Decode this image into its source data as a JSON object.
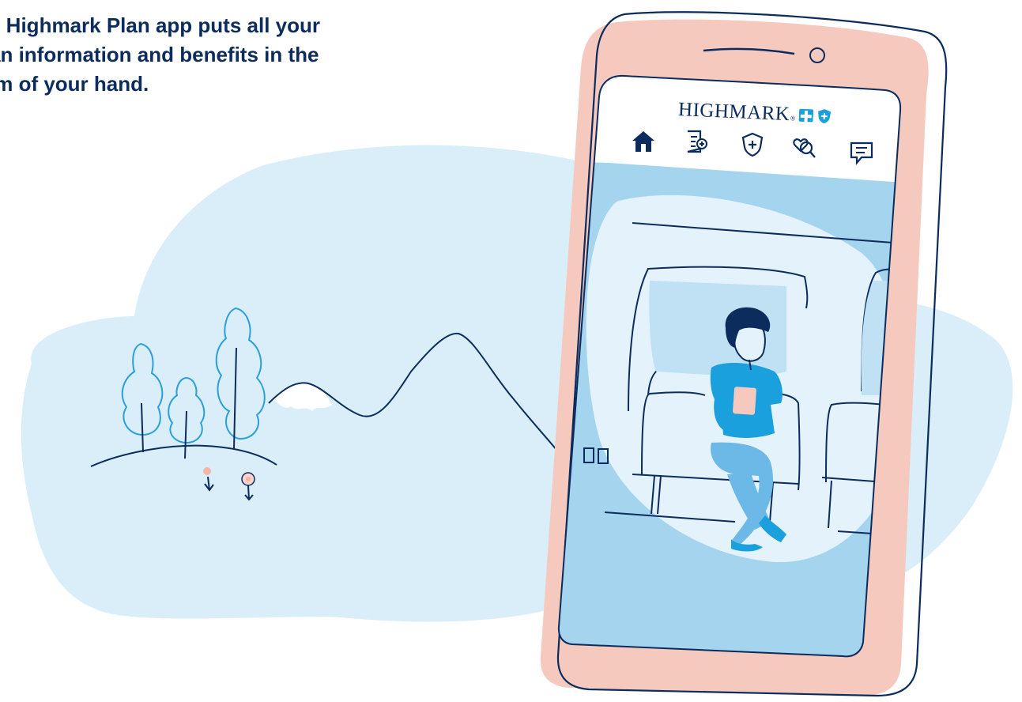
{
  "headline": "e Highmark Plan app puts all your\nan information and benefits in the\nlm of your hand.",
  "app": {
    "brand_name": "HIGHMARK",
    "brand_reg": "®",
    "brand_logos": [
      "blue-cross-icon",
      "blue-shield-icon"
    ],
    "nav_icons": [
      "home-icon",
      "claims-document-icon",
      "coverage-shield-icon",
      "find-care-search-icon",
      "messages-chat-icon"
    ]
  },
  "colors": {
    "navy": "#0b2c5c",
    "light_blue": "#d9eef8",
    "mid_blue": "#a5d4ee",
    "bright_blue": "#1aa0dc",
    "phone_pink": "#f6c9bf",
    "tree_blue": "#2a9fd8"
  }
}
